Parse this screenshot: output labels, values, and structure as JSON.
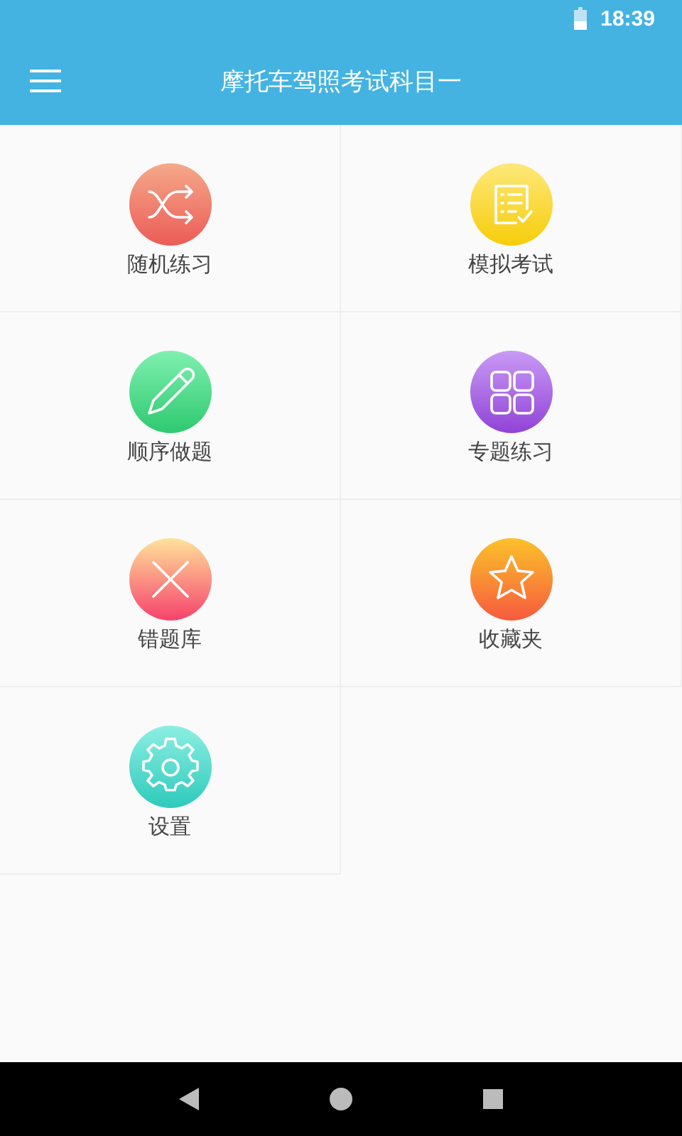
{
  "status_bar": {
    "time": "18:39"
  },
  "app_bar": {
    "title": "摩托车驾照考试科目一"
  },
  "menu": [
    {
      "label": "随机练习",
      "kind": "shuffle"
    },
    {
      "label": "模拟考试",
      "kind": "exam"
    },
    {
      "label": "顺序做题",
      "kind": "pencil"
    },
    {
      "label": "专题练习",
      "kind": "grid"
    },
    {
      "label": "错题库",
      "kind": "cross"
    },
    {
      "label": "收藏夹",
      "kind": "star"
    },
    {
      "label": "设置",
      "kind": "gear"
    }
  ]
}
